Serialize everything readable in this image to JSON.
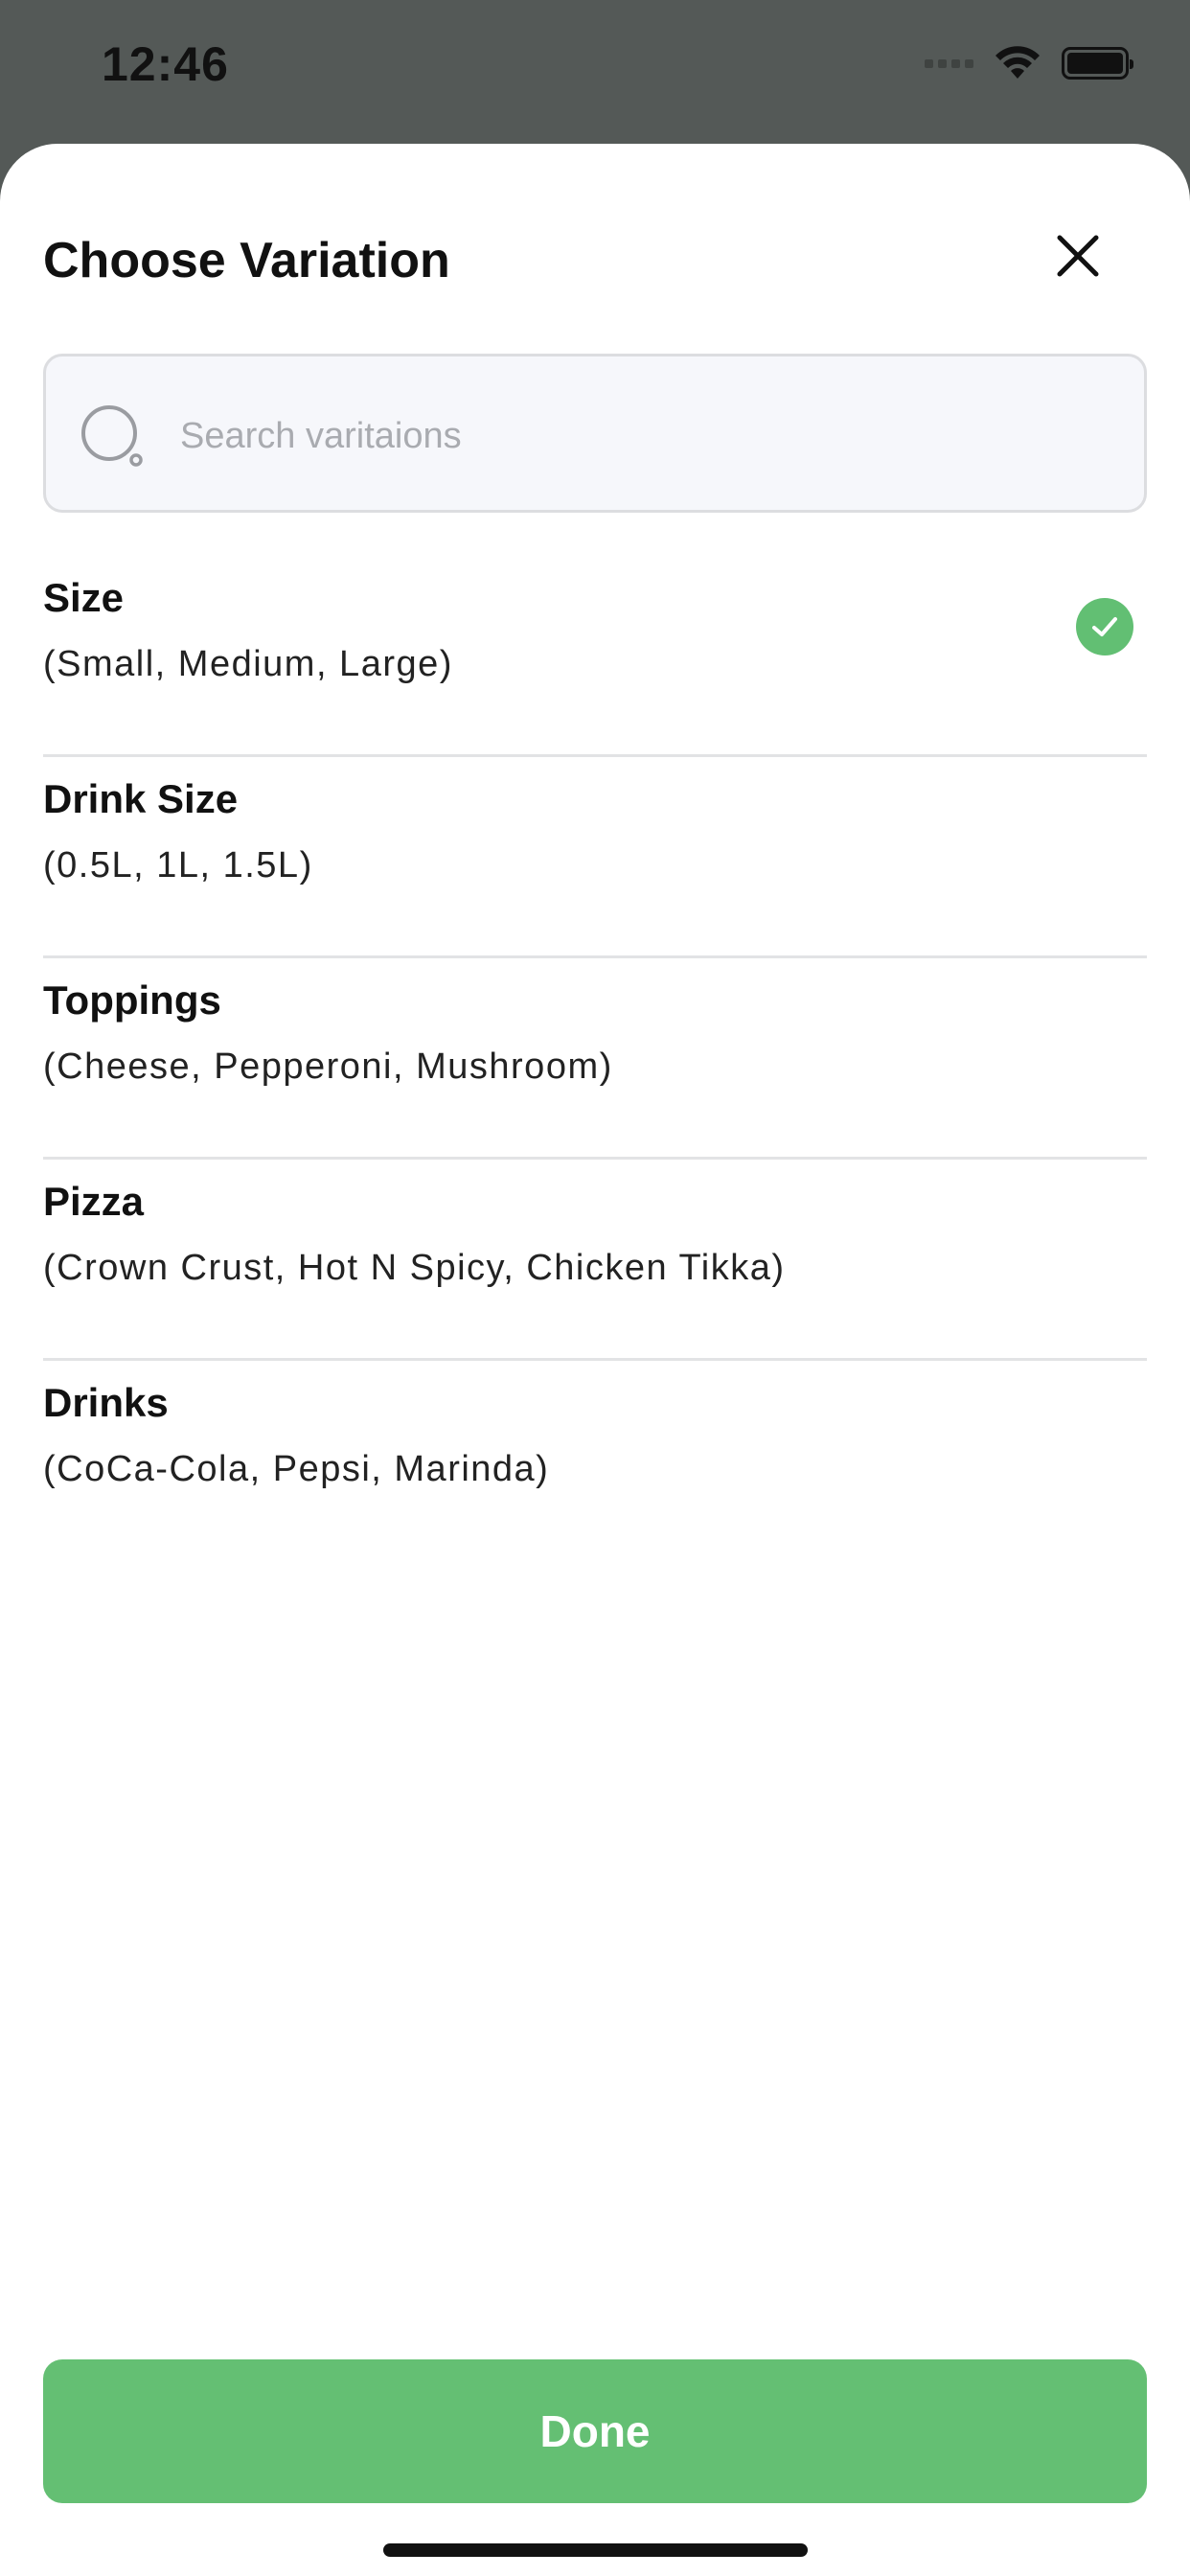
{
  "status_bar": {
    "time": "12:46",
    "icons": [
      "signal-dots-icon",
      "wifi-icon",
      "battery-icon"
    ]
  },
  "sheet": {
    "title": "Choose Variation",
    "close_icon": "close-icon"
  },
  "search": {
    "placeholder": "Search varitaions",
    "value": "",
    "icon": "search-icon"
  },
  "variations": [
    {
      "name": "Size",
      "options": "(Small, Medium, Large)",
      "selected": true
    },
    {
      "name": "Drink Size",
      "options": "(0.5L, 1L, 1.5L)",
      "selected": false
    },
    {
      "name": "Toppings",
      "options": "(Cheese, Pepperoni, Mushroom)",
      "selected": false
    },
    {
      "name": "Pizza",
      "options": "(Crown Crust, Hot N Spicy, Chicken Tikka)",
      "selected": false
    },
    {
      "name": "Drinks",
      "options": "(CoCa-Cola, Pepsi, Marinda)",
      "selected": false
    }
  ],
  "done_button": {
    "label": "Done"
  },
  "colors": {
    "accent": "#64bf73",
    "overlay": "#545957",
    "sheet": "#ffffff",
    "search_bg": "#f6f7fb"
  }
}
